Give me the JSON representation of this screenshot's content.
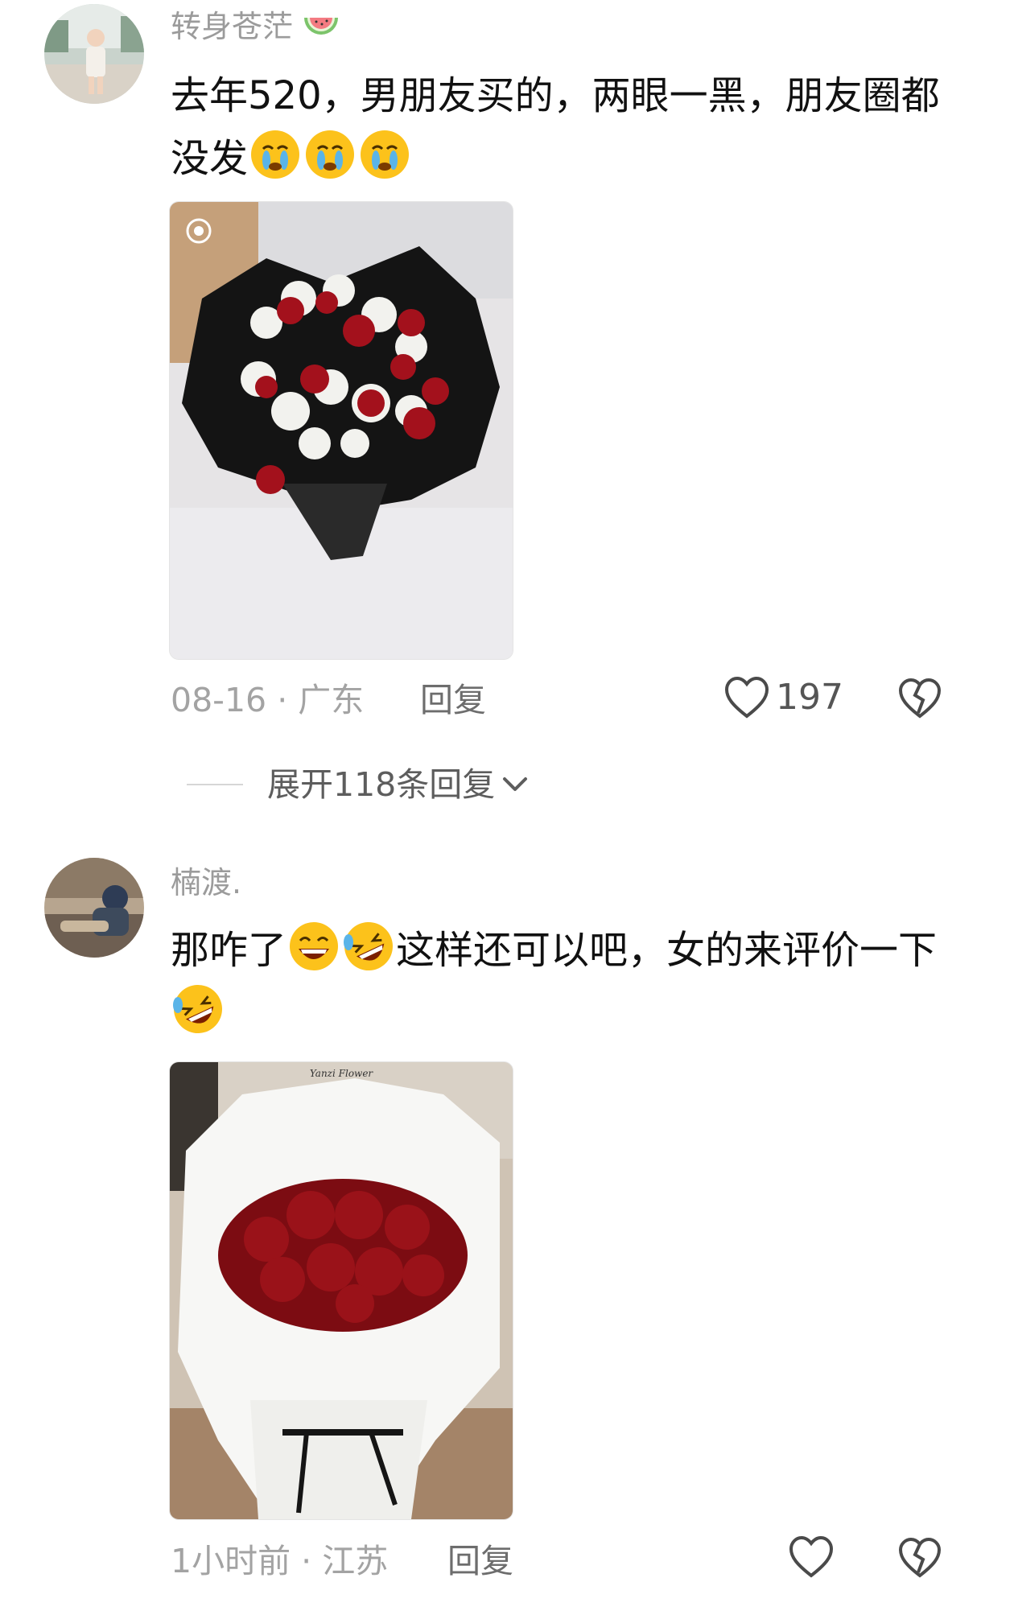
{
  "comments": [
    {
      "username": "转身苍茫",
      "text": "去年520，男朋友买的，两眼一黑，朋友圈都没发",
      "emojis": [
        "crying-face",
        "crying-face",
        "crying-face"
      ],
      "date": "08-16",
      "location": "广东",
      "reply_label": "回复",
      "likes": "197",
      "expand_replies": "展开118条回复",
      "photo": "black-wrapped-red-roses-bouquet"
    },
    {
      "username": "楠渡.",
      "text_before": "那咋了",
      "text_middle": "这样还可以吧，女的来评价一下",
      "emojis": [
        "grinning-face",
        "rolling-laughing-face",
        "rolling-laughing-face"
      ],
      "date": "1小时前",
      "location": "江苏",
      "reply_label": "回复",
      "photo": "white-wrapped-red-roses-bouquet",
      "brand_text": "Yanzi Flower"
    }
  ],
  "separator": "·",
  "colors": {
    "meta": "#a3a3a3",
    "username": "#9b9b9b",
    "text": "#111111"
  }
}
